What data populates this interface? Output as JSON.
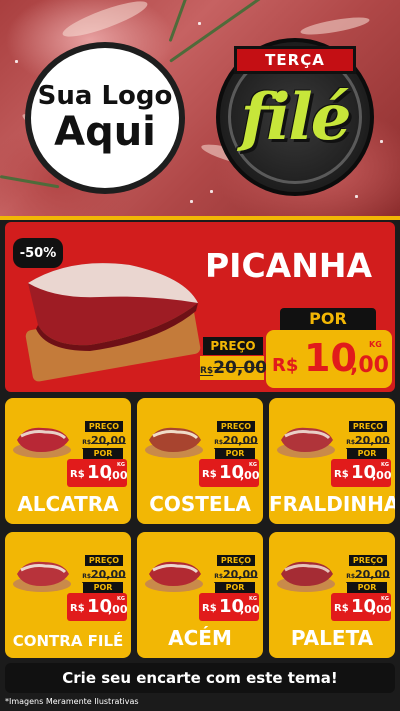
{
  "logo": {
    "line1": "Sua Logo",
    "line2": "Aqui"
  },
  "badge": {
    "day": "TERÇA",
    "title": "filé"
  },
  "featured": {
    "discount": "-50%",
    "name": "PICANHA",
    "old_label": "PREÇO",
    "old_currency": "R$",
    "old_price": "20,00",
    "new_label": "POR",
    "currency": "R$",
    "price_int": "10",
    "price_dec": ",00",
    "unit": "KG"
  },
  "products": [
    {
      "name": "ALCATRA",
      "old_label": "PREÇO",
      "old_price": "20,00",
      "new_label": "POR",
      "currency": "R$",
      "price_int": "10",
      "price_dec": ",00",
      "unit": "KG"
    },
    {
      "name": "COSTELA",
      "old_label": "PREÇO",
      "old_price": "20,00",
      "new_label": "POR",
      "currency": "R$",
      "price_int": "10",
      "price_dec": ",00",
      "unit": "KG"
    },
    {
      "name": "FRALDINHA",
      "old_label": "PREÇO",
      "old_price": "20,00",
      "new_label": "POR",
      "currency": "R$",
      "price_int": "10",
      "price_dec": ",00",
      "unit": "KG"
    },
    {
      "name": "CONTRA FILÉ",
      "old_label": "PREÇO",
      "old_price": "20,00",
      "new_label": "POR",
      "currency": "R$",
      "price_int": "10",
      "price_dec": ",00",
      "unit": "KG"
    },
    {
      "name": "ACÉM",
      "old_label": "PREÇO",
      "old_price": "20,00",
      "new_label": "POR",
      "currency": "R$",
      "price_int": "10",
      "price_dec": ",00",
      "unit": "KG"
    },
    {
      "name": "PALETA",
      "old_label": "PREÇO",
      "old_price": "20,00",
      "new_label": "POR",
      "currency": "R$",
      "price_int": "10",
      "price_dec": ",00",
      "unit": "KG"
    }
  ],
  "cta": "Crie seu encarte com este tema!",
  "disclaimer": "*Imagens Meramente Ilustrativas",
  "colors": {
    "red": "#d21d1d",
    "yellow": "#f2b705",
    "dark": "#111111",
    "lime": "#c7e63a"
  }
}
